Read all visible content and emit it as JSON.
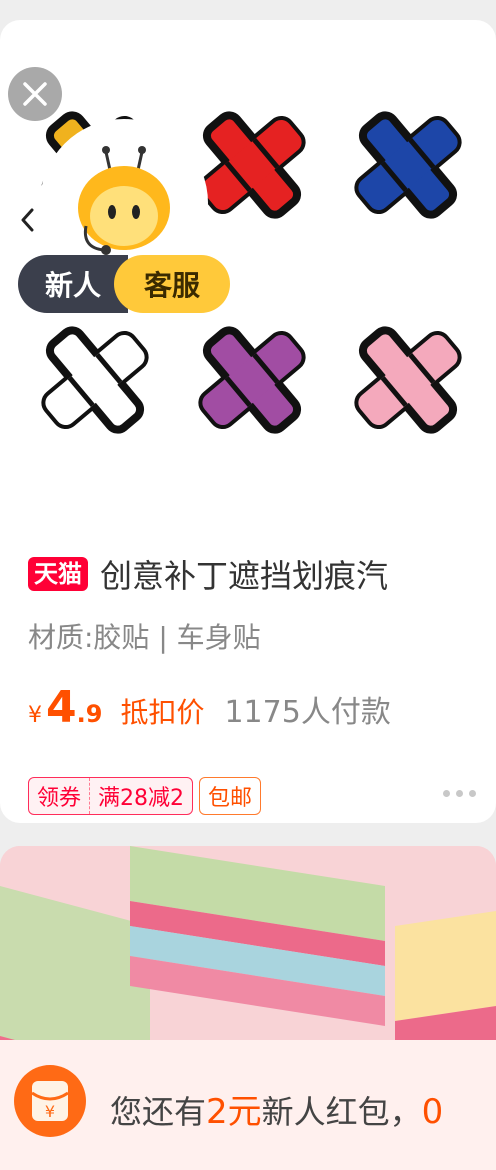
{
  "product": {
    "store_tag": "天猫",
    "title": "创意补丁遮挡划痕汽",
    "subtitle": "材质:胶贴 | 车身贴",
    "currency": "¥",
    "price_integer": "4",
    "price_decimal": ".9",
    "price_label": "抵扣价",
    "sold_count": "1175人付款",
    "coupon_label": "领券",
    "coupon_value": "满28减2",
    "shipping": "包邮",
    "patch_colors": [
      "#f0b21e",
      "#e52222",
      "#1d46a8",
      "#ffffff",
      "#a14da3",
      "#f4a9bc"
    ]
  },
  "service_badge": {
    "left": "新人",
    "right": "客服"
  },
  "banner": {
    "prefix": "您还有",
    "amount": "2元",
    "suffix": "新人红包，",
    "overflow": "0",
    "icon_glyph": "¥"
  },
  "icons": {
    "close": "close-icon",
    "back": "chevron-left-icon",
    "more": "more-dots-icon",
    "mascot": "mascot-avatar-icon",
    "red_packet": "red-packet-icon"
  }
}
